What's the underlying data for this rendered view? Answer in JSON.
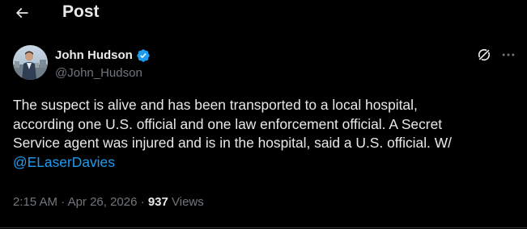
{
  "header": {
    "back_icon": "arrow-left-icon",
    "title": "Post"
  },
  "author": {
    "display_name": "John Hudson",
    "handle": "@John_Hudson",
    "verified_icon": "verified-badge-icon",
    "verified_color": "#1d9bf0"
  },
  "actions": {
    "grok_icon": "grok-icon",
    "more_icon": "more-dots-icon"
  },
  "tweet": {
    "lines": [
      "The suspect is alive and has been transported to a local hospital,",
      "according one U.S. official and one law enforcement official. A Secret",
      "Service agent was injured and is in the hospital, said a U.S. official. W/"
    ],
    "mention": "@ELaserDavies"
  },
  "meta": {
    "time": "2:15 AM",
    "separator": "·",
    "date": "Apr 26, 2026",
    "views_count": "937",
    "views_label": "Views"
  },
  "colors": {
    "background": "#000000",
    "text_primary": "#e7e9ea",
    "text_secondary": "#71767b",
    "accent": "#1d9bf0",
    "border": "#2f3336"
  }
}
